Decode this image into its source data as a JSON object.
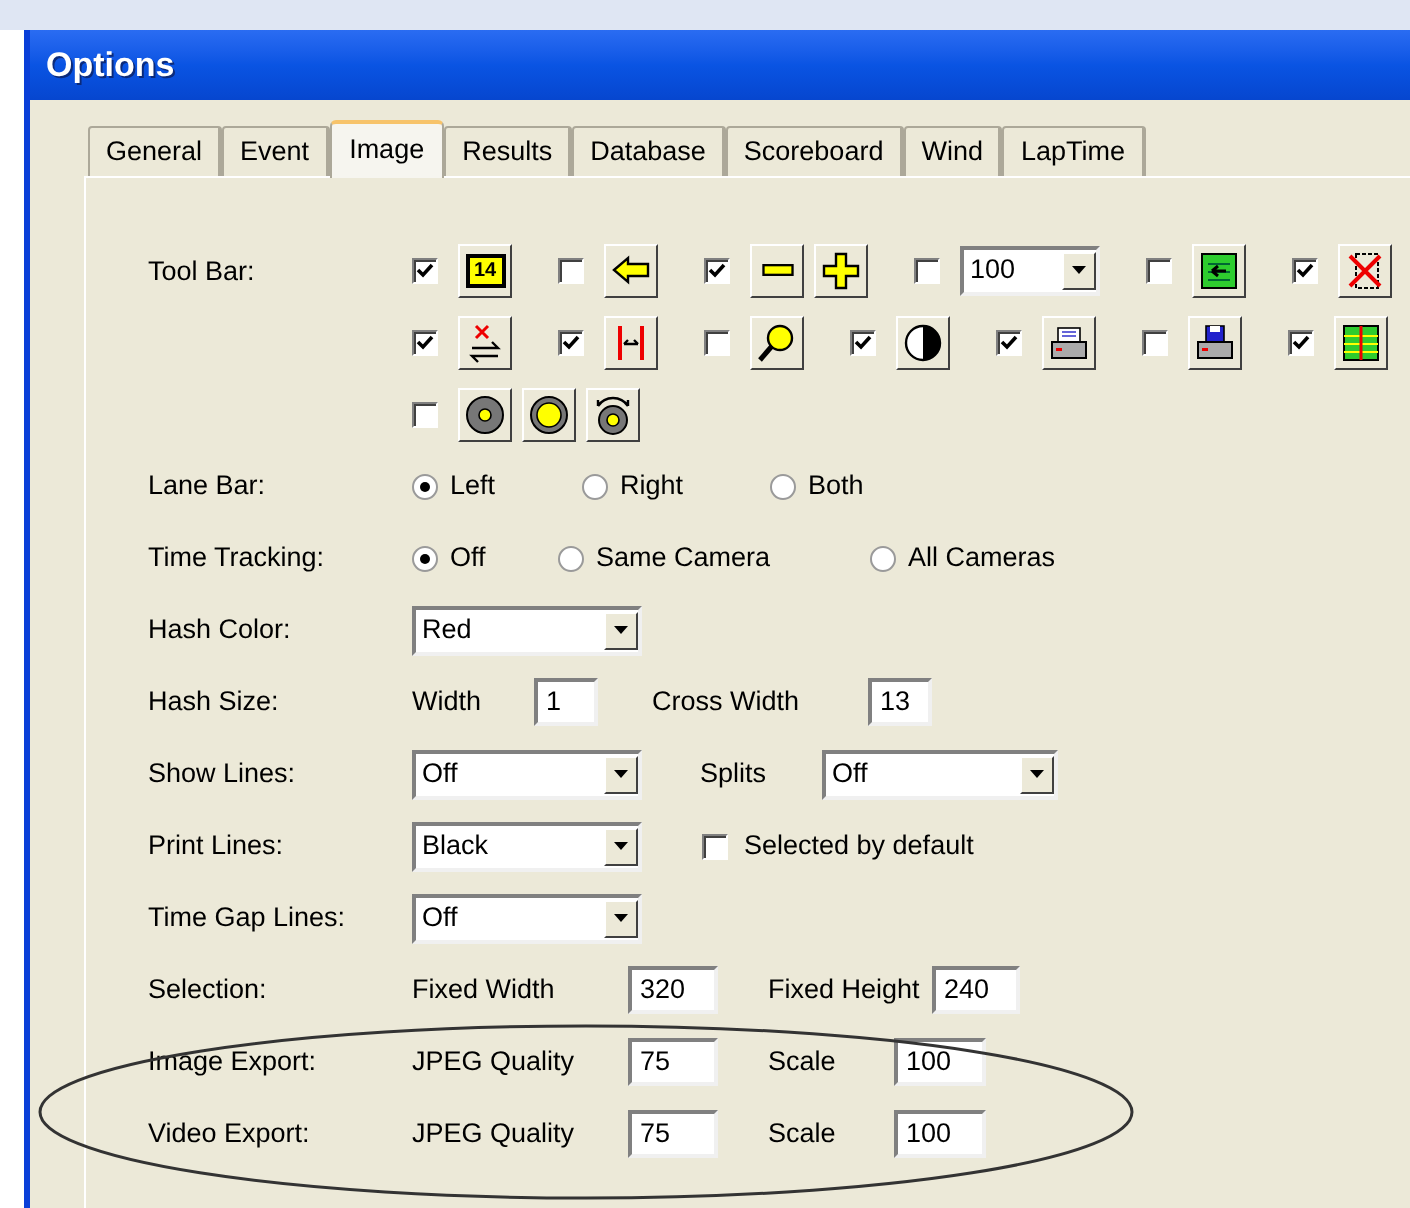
{
  "window": {
    "title": "Options"
  },
  "tabs": [
    {
      "label": "General",
      "selected": false
    },
    {
      "label": "Event",
      "selected": false
    },
    {
      "label": "Image",
      "selected": true
    },
    {
      "label": "Results",
      "selected": false
    },
    {
      "label": "Database",
      "selected": false
    },
    {
      "label": "Scoreboard",
      "selected": false
    },
    {
      "label": "Wind",
      "selected": false
    },
    {
      "label": "LapTime",
      "selected": false
    }
  ],
  "toolbar": {
    "label": "Tool Bar:",
    "rows": [
      [
        {
          "kind": "buttons",
          "checked": true,
          "badge": "14"
        },
        {
          "kind": "buttons",
          "checked": false
        },
        {
          "kind": "buttons",
          "checked": true
        },
        {
          "kind": "dropdown",
          "checked": false,
          "value": "100"
        },
        {
          "kind": "buttons",
          "checked": false
        },
        {
          "kind": "buttons",
          "checked": true
        }
      ],
      [
        {
          "kind": "buttons",
          "checked": true
        },
        {
          "kind": "buttons",
          "checked": true
        },
        {
          "kind": "buttons",
          "checked": false
        },
        {
          "kind": "buttons",
          "checked": true
        },
        {
          "kind": "buttons",
          "checked": true
        },
        {
          "kind": "buttons",
          "checked": false
        },
        {
          "kind": "buttons",
          "checked": true
        }
      ],
      [
        {
          "kind": "buttons",
          "checked": false
        }
      ]
    ]
  },
  "rows": [
    {
      "kind": "radio",
      "label": "Lane Bar:",
      "options": [
        {
          "label": "Left",
          "selected": true
        },
        {
          "label": "Right",
          "selected": false
        },
        {
          "label": "Both",
          "selected": false
        }
      ]
    },
    {
      "kind": "radio",
      "label": "Time Tracking:",
      "options": [
        {
          "label": "Off",
          "selected": true
        },
        {
          "label": "Same Camera",
          "selected": false
        },
        {
          "label": "All Cameras",
          "selected": false
        }
      ]
    },
    {
      "kind": "fields",
      "label": "Hash Color:",
      "items": [
        {
          "kind": "dropdown",
          "value": "Red"
        }
      ]
    },
    {
      "kind": "fields",
      "label": "Hash Size:",
      "items": [
        {
          "kind": "caption",
          "text": "Width"
        },
        {
          "kind": "input",
          "value": "1"
        },
        {
          "kind": "caption",
          "text": "Cross Width"
        },
        {
          "kind": "input",
          "value": "13"
        }
      ]
    },
    {
      "kind": "fields",
      "label": "Show Lines:",
      "items": [
        {
          "kind": "dropdown",
          "value": "Off"
        },
        {
          "kind": "caption",
          "text": "Splits"
        },
        {
          "kind": "dropdown",
          "value": "Off"
        }
      ]
    },
    {
      "kind": "fields",
      "label": "Print Lines:",
      "items": [
        {
          "kind": "dropdown",
          "value": "Black"
        },
        {
          "kind": "checkbox",
          "label": "Selected by default",
          "checked": false
        }
      ]
    },
    {
      "kind": "fields",
      "label": "Time Gap Lines:",
      "items": [
        {
          "kind": "dropdown",
          "value": "Off"
        }
      ]
    },
    {
      "kind": "fields",
      "label": "Selection:",
      "items": [
        {
          "kind": "caption",
          "text": "Fixed Width"
        },
        {
          "kind": "input",
          "value": "320"
        },
        {
          "kind": "caption",
          "text": "Fixed Height"
        },
        {
          "kind": "input",
          "value": "240"
        }
      ]
    },
    {
      "kind": "fields",
      "label": "Image Export:",
      "items": [
        {
          "kind": "caption",
          "text": "JPEG Quality"
        },
        {
          "kind": "input",
          "value": "75"
        },
        {
          "kind": "caption",
          "text": "Scale"
        },
        {
          "kind": "input",
          "value": "100"
        }
      ]
    },
    {
      "kind": "fields",
      "label": "Video Export:",
      "items": [
        {
          "kind": "caption",
          "text": "JPEG Quality"
        },
        {
          "kind": "input",
          "value": "75"
        },
        {
          "kind": "caption",
          "text": "Scale"
        },
        {
          "kind": "input",
          "value": "100"
        }
      ]
    }
  ]
}
